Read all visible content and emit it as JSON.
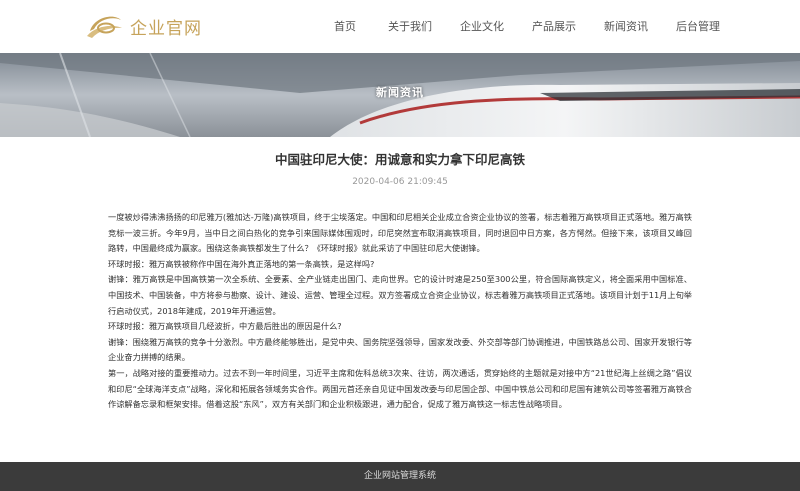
{
  "brand": {
    "name": "企业官网",
    "accent": "#c6a35a"
  },
  "nav": {
    "items": [
      {
        "label": "首页"
      },
      {
        "label": "关于我们"
      },
      {
        "label": "企业文化"
      },
      {
        "label": "产品展示"
      },
      {
        "label": "新闻资讯"
      },
      {
        "label": "后台管理"
      }
    ]
  },
  "banner": {
    "title": "新闻资讯"
  },
  "article": {
    "title": "中国驻印尼大使：用诚意和实力拿下印尼高铁",
    "date": "2020-04-06 21:09:45",
    "paragraphs": [
      "一度被炒得沸沸扬扬的印尼雅万(雅加达-万隆)高铁项目，终于尘埃落定。中国和印尼相关企业成立合资企业协议的签署，标志着雅万高铁项目正式落地。雅万高铁竞标一波三折。今年9月，当中日之间白热化的竞争引来国际媒体围观时，印尼突然宣布取消高铁项目，同时退回中日方案，各方愕然。但接下来，该项目又峰回路转，中国最终成为赢家。围绕这条高铁都发生了什么？《环球时报》就此采访了中国驻印尼大使谢锋。",
      "环球时报：雅万高铁被称作中国在海外真正落地的第一条高铁，是这样吗?",
      "谢锋：雅万高铁是中国高铁第一次全系统、全要素、全产业链走出国门、走向世界。它的设计时速是250至300公里，符合国际高铁定义，将全面采用中国标准、中国技术、中国装备，中方将参与勘察、设计、建设、运营、管理全过程。双方签署成立合资企业协议，标志着雅万高铁项目正式落地。该项目计划于11月上旬举行启动仪式，2018年建成，2019年开通运营。",
      "环球时报：雅万高铁项目几经波折，中方最后胜出的原因是什么?",
      "谢锋：围绕雅万高铁的竞争十分激烈。中方最终能够胜出，是党中央、国务院坚强领导，国家发改委、外交部等部门协调推进，中国铁路总公司、国家开发银行等企业奋力拼搏的结果。",
      "第一，战略对接的重要推动力。过去不到一年时间里，习近平主席和佐科总统3次来、往访，两次通话，贯穿始终的主题就是对接中方“21世纪海上丝绸之路”倡议和印尼“全球海洋支点”战略，深化和拓展各领域务实合作。两国元首还亲自见证中国发改委与印尼国企部、中国中铁总公司和印尼国有建筑公司等签署雅万高铁合作谅解备忘录和框架安排。借着这股“东风”，双方有关部门和企业积极跟进，通力配合，促成了雅万高铁这一标志性战略项目。"
    ]
  },
  "footer": {
    "text": "企业网站管理系统"
  }
}
